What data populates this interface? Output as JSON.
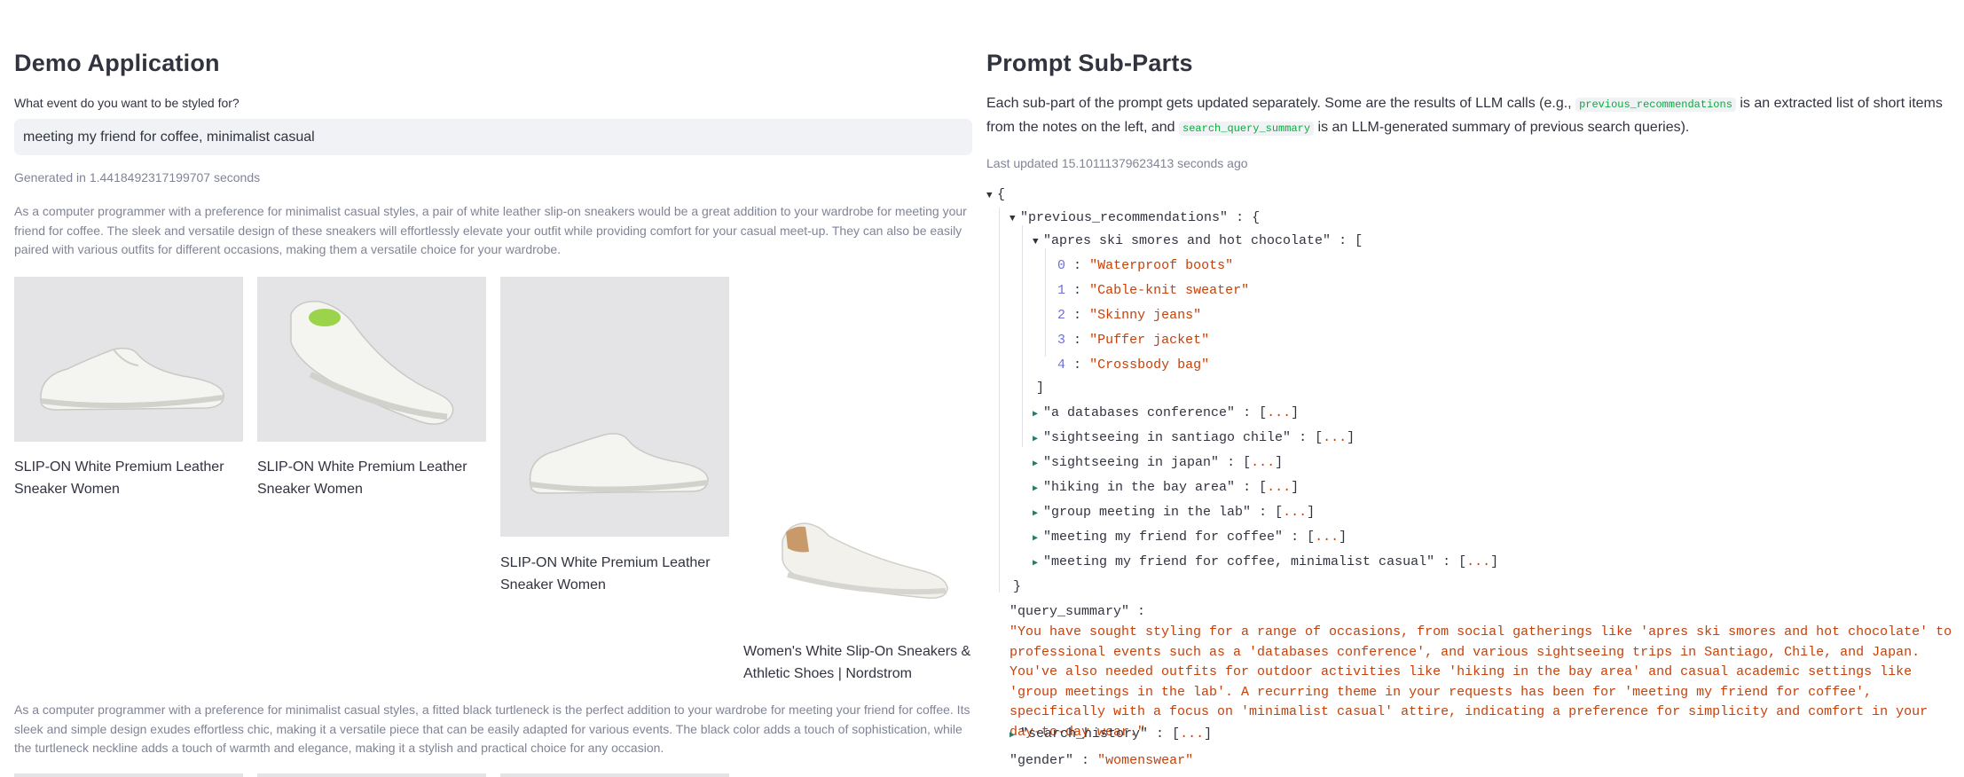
{
  "left": {
    "title": "Demo Application",
    "event_label": "What event do you want to be styled for?",
    "event_value": "meeting my friend for coffee, minimalist casual",
    "generated": "Generated in 1.4418492317199707 seconds",
    "recommendation_1": "As a computer programmer with a preference for minimalist casual styles, a pair of white leather slip-on sneakers would be a great addition to your wardrobe for meeting your friend for coffee. The sleek and versatile design of these sneakers will effortlessly elevate your outfit while providing comfort for your casual meet-up. They can also be easily paired with various outfits for different occasions, making them a versatile choice for your wardrobe.",
    "products": [
      {
        "title": "SLIP-ON White Premium Leather Sneaker Women"
      },
      {
        "title": "SLIP-ON White Premium Leather Sneaker Women"
      },
      {
        "title": "SLIP-ON White Premium Leather Sneaker Women"
      },
      {
        "title": "Women's White Slip-On Sneakers & Athletic Shoes | Nordstrom"
      }
    ],
    "recommendation_2": "As a computer programmer with a preference for minimalist casual styles, a fitted black turtleneck is the perfect addition to your wardrobe for meeting your friend for coffee. Its sleek and simple design exudes effortless chic, making it a versatile piece that can be easily adapted for various events. The black color adds a touch of sophistication, while the turtleneck neckline adds a touch of warmth and elegance, making it a stylish and practical choice for any occasion."
  },
  "right": {
    "title": "Prompt Sub-Parts",
    "desc_1": "Each sub-part of the prompt gets updated separately. Some are the results of LLM calls (e.g.,",
    "code_1": "previous_recommendations",
    "desc_2": "is an extracted list of short items from the notes on the left, and",
    "code_2": "search_query_summary",
    "desc_3": "is an LLM-generated summary of previous search queries).",
    "last_updated": "Last updated 15.10111379623413 seconds ago",
    "json": {
      "open_brace": "{",
      "prev_key": "\"previous_recommendations\"",
      "apres_key": "\"apres ski smores and hot chocolate\"",
      "apres_items": [
        {
          "idx": "0",
          "val": "\"Waterproof boots\""
        },
        {
          "idx": "1",
          "val": "\"Cable-knit sweater\""
        },
        {
          "idx": "2",
          "val": "\"Skinny jeans\""
        },
        {
          "idx": "3",
          "val": "\"Puffer jacket\""
        },
        {
          "idx": "4",
          "val": "\"Crossbody bag\""
        }
      ],
      "collapsed_keys": [
        "\"a databases conference\"",
        "\"sightseeing in santiago chile\"",
        "\"sightseeing in japan\"",
        "\"hiking in the bay area\"",
        "\"group meeting in the lab\"",
        "\"meeting my friend for coffee\"",
        "\"meeting my friend for coffee, minimalist casual\""
      ],
      "query_key": "\"query_summary\"",
      "query_value": "\"You have sought styling for a range of occasions, from social gatherings like 'apres ski smores and hot chocolate' to professional events such as a 'databases conference', and various sightseeing trips in Santiago, Chile, and Japan. You've also needed outfits for outdoor activities like 'hiking in the bay area' and casual academic settings like 'group meetings in the lab'. A recurring theme in your requests has been for 'meeting my friend for coffee', specifically with a focus on 'minimalist casual' attire, indicating a preference for simplicity and comfort in your day-to-day wear.\"",
      "search_key": "\"search_history\"",
      "gender_key": "\"gender\"",
      "gender_val": "\"womenswear\"",
      "colon": ":",
      "bracket_open": "[",
      "bracket_close": "]",
      "brace_open": "{",
      "brace_close": "}",
      "ellipsis": "...",
      "collapsed_open": "[",
      "collapsed_close": "]"
    }
  }
}
